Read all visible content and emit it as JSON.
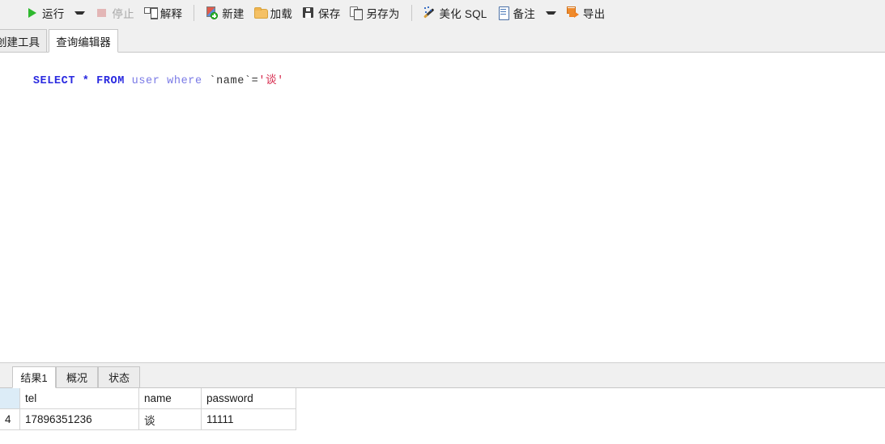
{
  "toolbar": {
    "items": [
      {
        "id": "run",
        "label": "运行",
        "icon": "play-icon",
        "disabled": false,
        "caret": true
      },
      {
        "id": "stop",
        "label": "停止",
        "icon": "stop-square-icon",
        "disabled": true,
        "caret": false
      },
      {
        "id": "explain",
        "label": "解释",
        "icon": "explain-plan-icon",
        "disabled": false,
        "caret": false
      },
      {
        "id": "new",
        "label": "新建",
        "icon": "new-document-icon",
        "disabled": false,
        "caret": false
      },
      {
        "id": "load",
        "label": "加载",
        "icon": "folder-open-icon",
        "disabled": false,
        "caret": false
      },
      {
        "id": "save",
        "label": "保存",
        "icon": "floppy-disk-icon",
        "disabled": false,
        "caret": false
      },
      {
        "id": "save_as",
        "label": "另存为",
        "icon": "copy-pages-icon",
        "disabled": false,
        "caret": false
      },
      {
        "id": "beautify",
        "label": "美化 SQL",
        "icon": "magic-wand-icon",
        "disabled": false,
        "caret": false
      },
      {
        "id": "note",
        "label": "备注",
        "icon": "note-document-icon",
        "disabled": false,
        "caret": true
      },
      {
        "id": "export",
        "label": "导出",
        "icon": "export-arrow-icon",
        "disabled": false,
        "caret": false
      }
    ]
  },
  "top_tabs": {
    "items": [
      {
        "id": "create_tool",
        "label": "创建工具",
        "active": false
      },
      {
        "id": "query_editor",
        "label": "查询编辑器",
        "active": true
      }
    ]
  },
  "editor": {
    "sql_tokens": [
      {
        "text": "SELECT",
        "type": "keyword"
      },
      {
        "text": " ",
        "type": "plain"
      },
      {
        "text": "*",
        "type": "star"
      },
      {
        "text": " ",
        "type": "plain"
      },
      {
        "text": "FROM",
        "type": "keyword"
      },
      {
        "text": " ",
        "type": "plain"
      },
      {
        "text": "user",
        "type": "identifier"
      },
      {
        "text": " ",
        "type": "plain"
      },
      {
        "text": "where",
        "type": "identifier"
      },
      {
        "text": " ",
        "type": "plain"
      },
      {
        "text": "`name`",
        "type": "quoted-identifier"
      },
      {
        "text": "=",
        "type": "operator"
      },
      {
        "text": "'谈'",
        "type": "string"
      }
    ],
    "sql_text": "SELECT * FROM user where `name`='谈'"
  },
  "result_tabs": {
    "items": [
      {
        "id": "result1",
        "label": "结果1",
        "active": true
      },
      {
        "id": "profile",
        "label": "概况",
        "active": false
      },
      {
        "id": "status",
        "label": "状态",
        "active": false
      }
    ]
  },
  "result_grid": {
    "columns": [
      "",
      "tel",
      "name",
      "password"
    ],
    "rows": [
      {
        "row_number": "4",
        "tel": "17896351236",
        "name": "谈",
        "password": "11111"
      }
    ]
  },
  "colors": {
    "toolbar_background": "#f0f0f0",
    "editor_background": "#ffffff",
    "keyword": "#2a2ae0",
    "identifier": "#7a7ae6",
    "string": "#d6274a",
    "run_green": "#2eb82e",
    "export_orange": "#ef8a2b",
    "folder_yellow": "#f5c165",
    "grid_header_tint": "#dcecf7",
    "border": "#c6c6c6"
  }
}
